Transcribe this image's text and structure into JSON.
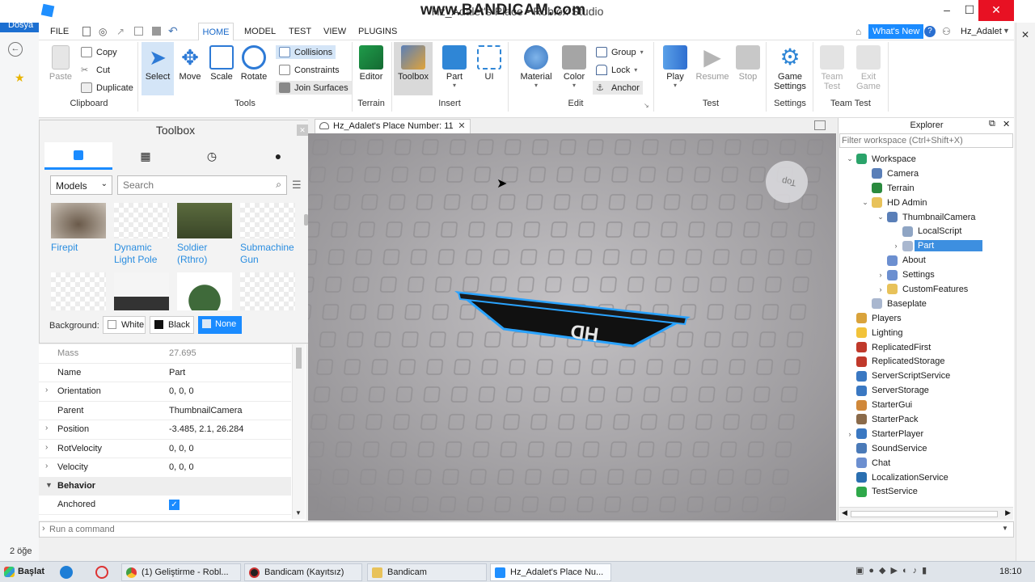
{
  "window": {
    "title": "Hz_Adalet's Place - Roblox Studio",
    "watermark": "www.BANDICAM.com"
  },
  "menu": {
    "file": "FILE",
    "tabs": [
      "HOME",
      "MODEL",
      "TEST",
      "VIEW",
      "PLUGINS"
    ],
    "whats_new": "What's New",
    "user": "Hz_Adalet"
  },
  "ribbon": {
    "clipboard": {
      "paste": "Paste",
      "copy": "Copy",
      "cut": "Cut",
      "duplicate": "Duplicate",
      "label": "Clipboard"
    },
    "tools": {
      "select": "Select",
      "move": "Move",
      "scale": "Scale",
      "rotate": "Rotate",
      "collisions": "Collisions",
      "constraints": "Constraints",
      "join": "Join Surfaces",
      "label": "Tools"
    },
    "terrain": {
      "editor": "Editor",
      "label": "Terrain"
    },
    "insert": {
      "toolbox": "Toolbox",
      "part": "Part",
      "ui": "UI",
      "label": "Insert"
    },
    "edit": {
      "material": "Material",
      "color": "Color",
      "group": "Group",
      "lock": "Lock",
      "anchor": "Anchor",
      "label": "Edit"
    },
    "test": {
      "play": "Play",
      "resume": "Resume",
      "stop": "Stop",
      "label": "Test"
    },
    "settings": {
      "game1": "Game",
      "game2": "Settings",
      "label": "Settings"
    },
    "teamtest": {
      "team1": "Team",
      "team2": "Test",
      "exit1": "Exit",
      "exit2": "Game",
      "label": "Team Test"
    }
  },
  "toolbox": {
    "title": "Toolbox",
    "category": "Models",
    "search_placeholder": "Search",
    "items": [
      {
        "name": "Firepit"
      },
      {
        "name": "Dynamic Light Pole"
      },
      {
        "name": "Soldier (Rthro)"
      },
      {
        "name": "Submachine Gun"
      }
    ],
    "background_label": "Background:",
    "bg_white": "White",
    "bg_black": "Black",
    "bg_none": "None"
  },
  "properties": {
    "rows": [
      {
        "k": "Mass",
        "v": "27.695",
        "exp": false,
        "dim": true
      },
      {
        "k": "Name",
        "v": "Part",
        "exp": false
      },
      {
        "k": "Orientation",
        "v": "0, 0, 0",
        "exp": true
      },
      {
        "k": "Parent",
        "v": "ThumbnailCamera",
        "exp": false
      },
      {
        "k": "Position",
        "v": "-3.485, 2.1, 26.284",
        "exp": true
      },
      {
        "k": "RotVelocity",
        "v": "0, 0, 0",
        "exp": true
      },
      {
        "k": "Velocity",
        "v": "0, 0, 0",
        "exp": true
      }
    ],
    "section": "Behavior",
    "anchored": "Anchored"
  },
  "viewport": {
    "tab": "Hz_Adalet's Place Number: 11",
    "cube_label": "Top",
    "hd_text": "HD"
  },
  "explorer": {
    "title": "Explorer",
    "filter_placeholder": "Filter workspace (Ctrl+Shift+X)",
    "items": [
      {
        "label": "Workspace",
        "depth": 0,
        "exp": "open",
        "icon": "#2aa36a"
      },
      {
        "label": "Camera",
        "depth": 1,
        "exp": "",
        "icon": "#5a7fb8"
      },
      {
        "label": "Terrain",
        "depth": 1,
        "exp": "",
        "icon": "#2a8a3e"
      },
      {
        "label": "HD Admin",
        "depth": 1,
        "exp": "open",
        "icon": "#e8c25a"
      },
      {
        "label": "ThumbnailCamera",
        "depth": 2,
        "exp": "open",
        "icon": "#5a7fb8"
      },
      {
        "label": "LocalScript",
        "depth": 3,
        "exp": "",
        "icon": "#8fa5c4"
      },
      {
        "label": "Part",
        "depth": 3,
        "exp": "closed",
        "icon": "#a9b7cf",
        "selected": true
      },
      {
        "label": "About",
        "depth": 2,
        "exp": "",
        "icon": "#6c8fd0"
      },
      {
        "label": "Settings",
        "depth": 2,
        "exp": "closed",
        "icon": "#6c8fd0"
      },
      {
        "label": "CustomFeatures",
        "depth": 2,
        "exp": "closed",
        "icon": "#e8c25a"
      },
      {
        "label": "Baseplate",
        "depth": 1,
        "exp": "",
        "icon": "#a9b7cf"
      },
      {
        "label": "Players",
        "depth": 0,
        "exp": "",
        "icon": "#d9a33b"
      },
      {
        "label": "Lighting",
        "depth": 0,
        "exp": "",
        "icon": "#f2c33a"
      },
      {
        "label": "ReplicatedFirst",
        "depth": 0,
        "exp": "",
        "icon": "#c0392b"
      },
      {
        "label": "ReplicatedStorage",
        "depth": 0,
        "exp": "",
        "icon": "#c0392b"
      },
      {
        "label": "ServerScriptService",
        "depth": 0,
        "exp": "",
        "icon": "#3a78c2"
      },
      {
        "label": "ServerStorage",
        "depth": 0,
        "exp": "",
        "icon": "#3a78c2"
      },
      {
        "label": "StarterGui",
        "depth": 0,
        "exp": "",
        "icon": "#d0883a"
      },
      {
        "label": "StarterPack",
        "depth": 0,
        "exp": "",
        "icon": "#8a6a4a"
      },
      {
        "label": "StarterPlayer",
        "depth": 0,
        "exp": "closed",
        "icon": "#3a78c2"
      },
      {
        "label": "SoundService",
        "depth": 0,
        "exp": "",
        "icon": "#4a7ab8"
      },
      {
        "label": "Chat",
        "depth": 0,
        "exp": "",
        "icon": "#6c8fd0"
      },
      {
        "label": "LocalizationService",
        "depth": 0,
        "exp": "",
        "icon": "#2a6fb0"
      },
      {
        "label": "TestService",
        "depth": 0,
        "exp": "",
        "icon": "#2ea84a"
      }
    ]
  },
  "command": {
    "placeholder": "Run a command"
  },
  "left_strip": {
    "text1": "Dosya",
    "text2": "2 öğe"
  },
  "taskbar": {
    "start": "Başlat",
    "tasks": [
      "(1) Geliştirme - Robl...",
      "Bandicam (Kayıtsız)",
      "Bandicam",
      "Hz_Adalet's Place Nu..."
    ],
    "clock": "18:10"
  }
}
